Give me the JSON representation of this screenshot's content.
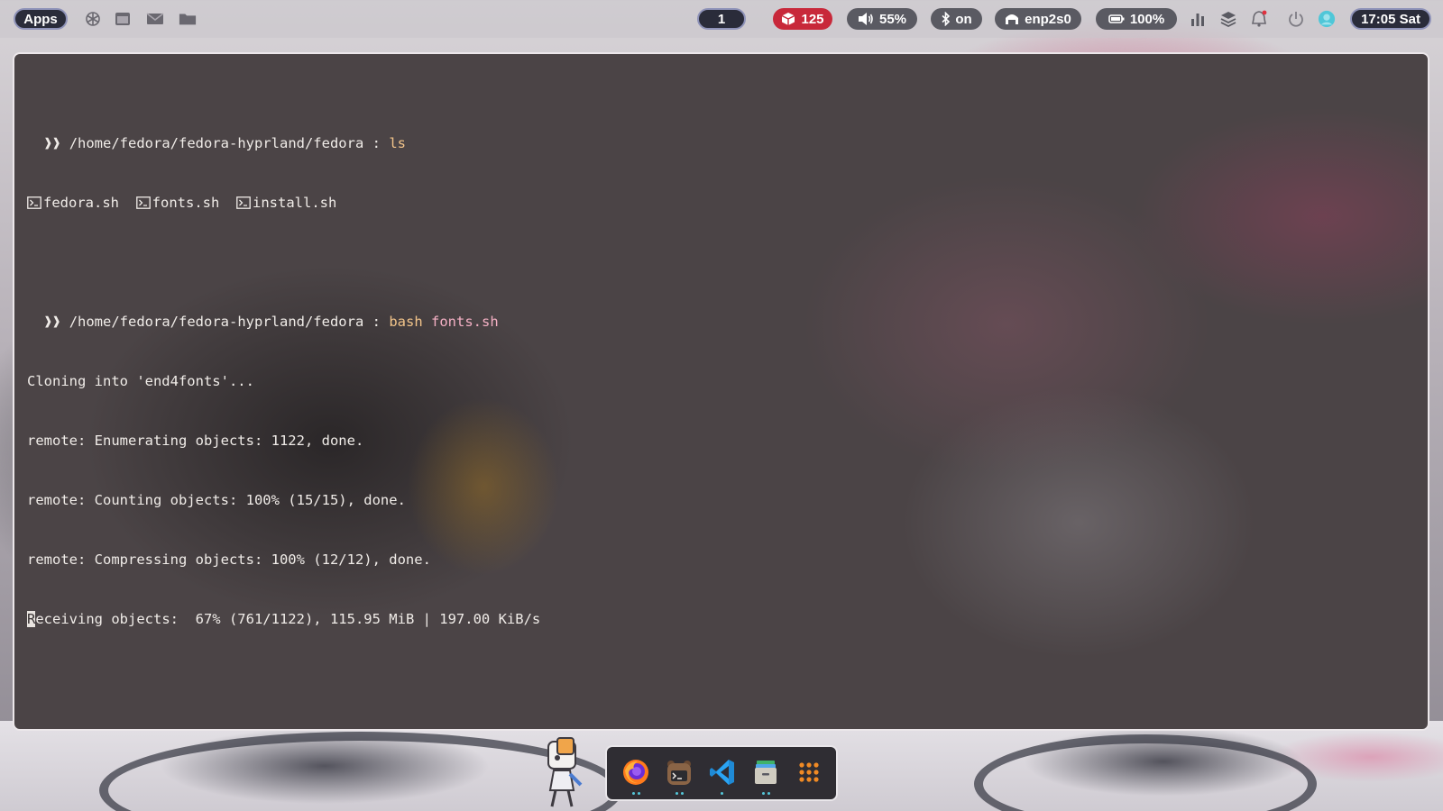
{
  "topbar": {
    "apps_label": "Apps",
    "workspace": "1",
    "updates": "125",
    "volume": "55%",
    "bluetooth": "on",
    "network": "enp2s0",
    "battery": "100%",
    "clock": "17:05 Sat",
    "icons": [
      "openai-icon",
      "window-icon",
      "mail-icon",
      "folder-icon",
      "stats-icon",
      "layers-icon",
      "bell-icon",
      "power-icon",
      "avatar-icon"
    ],
    "colors": {
      "updates_bg": "#c8283a",
      "pill_dark": "#2a2c3a",
      "pill_grey": "#5a5a62",
      "notification_dot": "#e0303e"
    }
  },
  "terminal": {
    "prompt_symbol": "❱❱",
    "line1": {
      "path": "/home/fedora/fedora-hyprland/fedora",
      "sep": ":",
      "command": "ls"
    },
    "files": [
      "fedora.sh",
      "fonts.sh",
      "install.sh"
    ],
    "line2": {
      "path": "/home/fedora/fedora-hyprland/fedora",
      "sep": ":",
      "command": "bash",
      "argument": "fonts.sh"
    },
    "output": [
      "Cloning into 'end4fonts'...",
      "remote: Enumerating objects: 1122, done.",
      "remote: Counting objects: 100% (15/15), done.",
      "remote: Compressing objects: 100% (12/12), done."
    ],
    "progress_cursor_char": "R",
    "progress_rest": "eceiving objects:  67% (761/1122), 115.95 MiB | 197.00 KiB/s",
    "colors": {
      "text": "#f0ece8",
      "command": "#f2c48a",
      "argument": "#f4b0c4"
    }
  },
  "dock": {
    "items": [
      "firefox-icon",
      "terminal-icon",
      "vscode-icon",
      "files-icon",
      "app-grid-icon"
    ]
  }
}
